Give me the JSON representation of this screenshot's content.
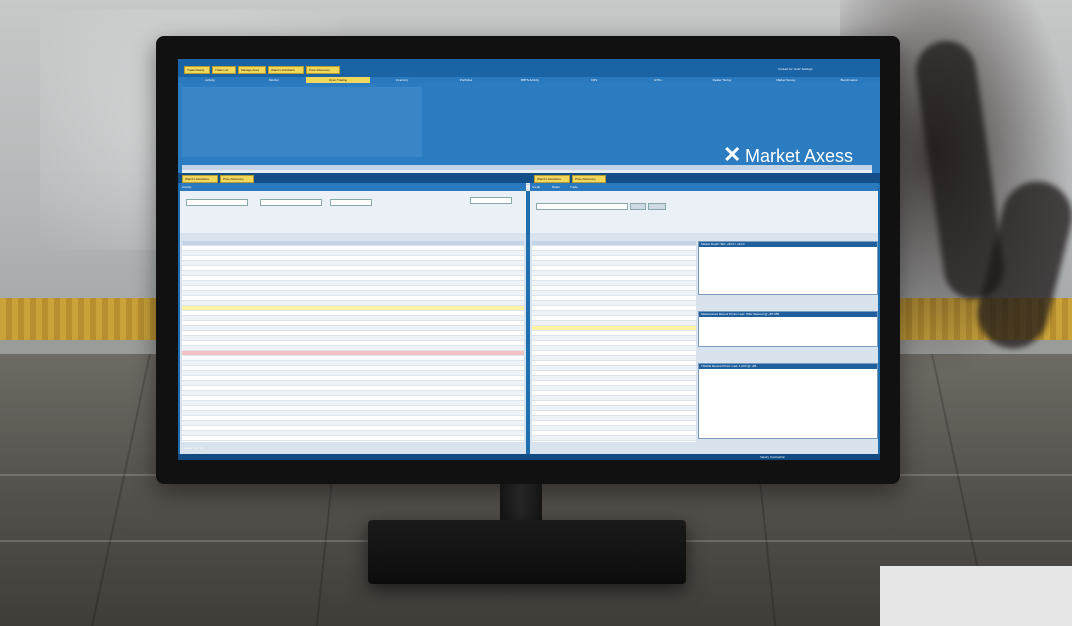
{
  "app": {
    "top_buttons": [
      "Trade Ready",
      "Trade List",
      "Manage Axes",
      "Watch Lists/Alerts",
      "Price Discovery"
    ],
    "nav_tabs": [
      "Activity",
      "Monitor",
      "Open Trading",
      "Inventory",
      "Portfolios",
      "BBTS Activity",
      "CDS",
      "ETFs",
      "Dealer Tiering",
      "Market Survey",
      "Benchmarks"
    ],
    "logo_text": "Market Axess",
    "left_panel_tabs": [
      "Activity",
      "Monitor",
      "Open Tr...",
      "Inventory",
      "BBTS A...",
      "CDS",
      "ETFs",
      "Portfolio",
      "Market",
      "Benchm...",
      "Security",
      "Treasury"
    ],
    "right_panel_tabs": [
      "Credit",
      "Rates",
      "Trade"
    ],
    "notice": "Contact for 'Auto' Settings",
    "right_boxes": [
      "Market Depth: Bid: +80.0 / +94.0",
      "Marketaxess Recent Prints: Last: Offer Wanted @ +87.055",
      "TRACE Recent Prints: Last: 1,000 @ +85"
    ],
    "status_left": "Loans: 11 / 1.1",
    "status_right": "Inquiry Contraction"
  },
  "colors": {
    "screen": "#1f6fb0",
    "accent_yellow": "#f1d85a",
    "grid_highlight": "#fff3a6"
  }
}
